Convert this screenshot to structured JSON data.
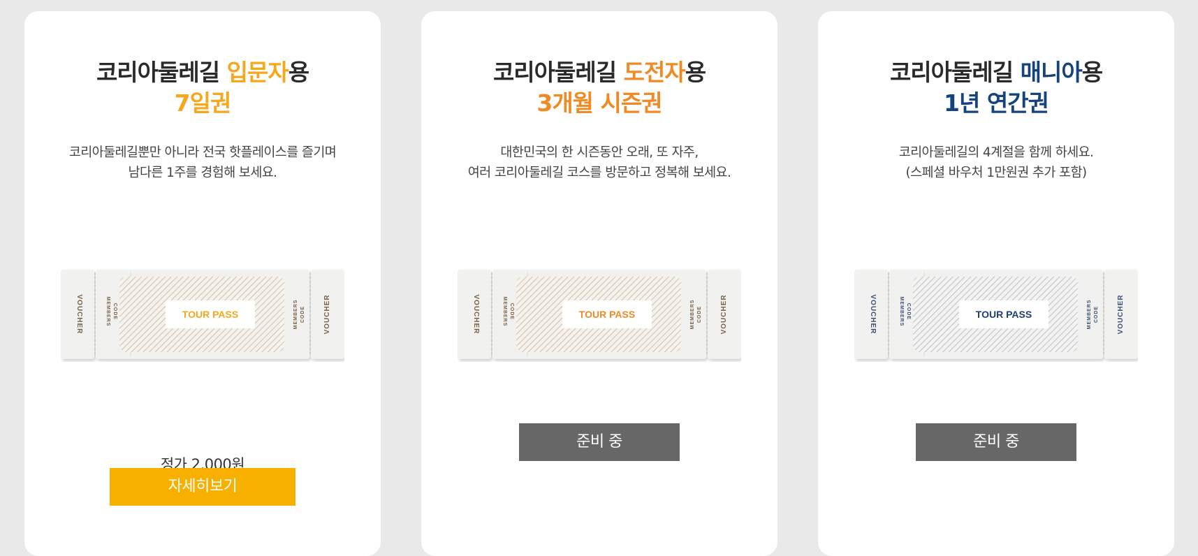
{
  "cards": [
    {
      "title_prefix": "코리아둘레길 ",
      "title_highlight": "입문자",
      "title_suffix": "용",
      "subtitle": "7일권",
      "accent": "#f5a81d",
      "desc": [
        "코리아둘레길뿐만 아니라 전국 핫플레이스를 즐기며",
        "남다른 1주를 경험해 보세요."
      ],
      "ticket": {
        "voucher_label": "VOUCHER",
        "members_code_label": [
          "MEMBERS",
          "CODE"
        ],
        "center_label": "TOUR PASS",
        "center_text_color": "#f5a81d",
        "pattern_color": "#c5b39a",
        "side_text_color": "#7a6146"
      },
      "price": "정가 2,000원",
      "button": {
        "label": "자세히보기",
        "color": "#f7b000"
      }
    },
    {
      "title_prefix": "코리아둘레길 ",
      "title_highlight": "도전자",
      "title_suffix": "용",
      "subtitle": "3개월 시즌권",
      "accent": "#f08a24",
      "desc": [
        "대한민국의 한 시즌동안 오래, 또 자주,",
        "여러 코리아둘레길 코스를 방문하고 정복해 보세요."
      ],
      "ticket": {
        "voucher_label": "VOUCHER",
        "members_code_label": [
          "MEMBERS",
          "CODE"
        ],
        "center_label": "TOUR PASS",
        "center_text_color": "#f08a24",
        "pattern_color": "#c5b39a",
        "side_text_color": "#7a6146"
      },
      "button": {
        "label": "준비 중",
        "color": "#676767"
      }
    },
    {
      "title_prefix": "코리아둘레길 ",
      "title_highlight": "매니아",
      "title_suffix": "용",
      "subtitle": "1년 연간권",
      "accent": "#14437e",
      "desc": [
        "코리아둘레길의 4계절을 함께 하세요.",
        "(스페셜 바우처 1만원권 추가 포함)"
      ],
      "ticket": {
        "voucher_label": "VOUCHER",
        "members_code_label": [
          "MEMBERS",
          "CODE"
        ],
        "center_label": "TOUR PASS",
        "center_text_color": "#1d3f75",
        "pattern_color": "#a3b5d4",
        "side_text_color": "#3b5176"
      },
      "button": {
        "label": "준비 중",
        "color": "#676767"
      }
    }
  ]
}
